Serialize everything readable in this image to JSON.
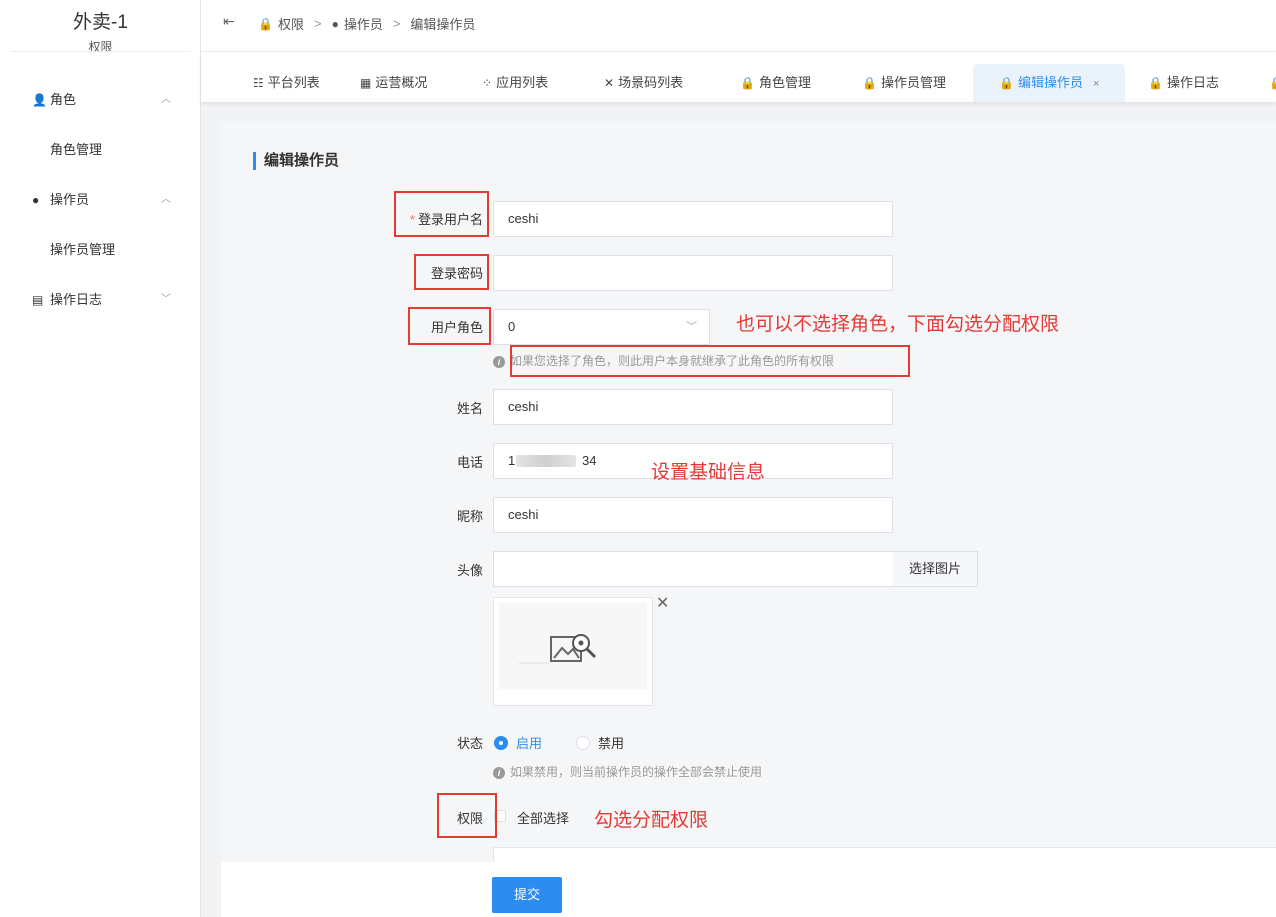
{
  "sidebar": {
    "title": "外卖-1",
    "subtitle": "权限",
    "groups": [
      {
        "label": "角色",
        "icon": "user-group-icon",
        "sub": "角色管理"
      },
      {
        "label": "操作员",
        "icon": "user-circle-icon",
        "sub": "操作员管理"
      },
      {
        "label": "操作日志",
        "icon": "file-icon"
      }
    ]
  },
  "breadcrumb": [
    "权限",
    "操作员",
    "编辑操作员"
  ],
  "tabs": [
    "平台列表",
    "运营概况",
    "应用列表",
    "场景码列表",
    "角色管理",
    "操作员管理",
    "编辑操作员",
    "操作日志"
  ],
  "active_tab_index": 6,
  "form": {
    "section_title": "编辑操作员",
    "username": {
      "label": "登录用户名",
      "required_mark": "*",
      "value": "ceshi"
    },
    "password": {
      "label": "登录密码",
      "value": ""
    },
    "role": {
      "label": "用户角色",
      "value": "0",
      "hint": "如果您选择了角色，则此用户本身就继承了此角色的所有权限"
    },
    "name": {
      "label": "姓名",
      "value": "ceshi"
    },
    "phone": {
      "label": "电话",
      "value_start": "1",
      "value_end": "34"
    },
    "nickname": {
      "label": "昵称",
      "value": "ceshi"
    },
    "avatar": {
      "label": "头像",
      "value": "",
      "button": "选择图片"
    },
    "status": {
      "label": "状态",
      "options": [
        "启用",
        "禁用"
      ],
      "selected": "启用",
      "hint": "如果禁用，则当前操作员的操作全部会禁止使用"
    },
    "permissions": {
      "label": "权限",
      "select_all": "全部选择",
      "checked": false
    },
    "submit": "提交"
  },
  "annotations": {
    "role_note": "也可以不选择角色，下面勾选分配权限",
    "basic_note": "设置基础信息",
    "perm_note": "勾选分配权限"
  },
  "colors": {
    "accent": "#2d8cf0",
    "annotation": "#e53935"
  }
}
